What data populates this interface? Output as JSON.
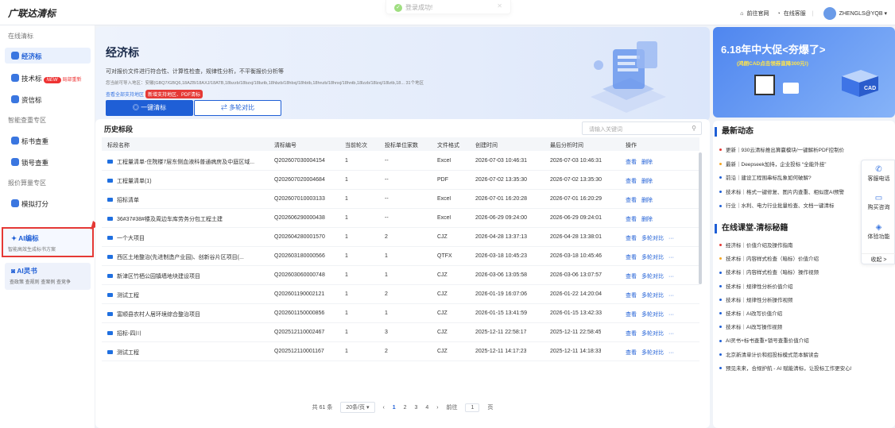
{
  "app": {
    "logo": "广联达清标",
    "toast": "登录成功!",
    "nav_official": "前往官网",
    "nav_service": "在线客服",
    "user": "ZHENGLS@YQB ▾"
  },
  "sidebar": {
    "group1": "在线清标",
    "item_jjb": "经济标",
    "item_jsb": "技术标",
    "new_badge": "NEW",
    "new_text": "局部重新",
    "item_zxb": "资信标",
    "group2": "智能查重专区",
    "item_bscz": "标书查重",
    "item_scz": "锁号查重",
    "group3": "报价算量专区",
    "item_mndf": "模拟打分",
    "ai_title": "AI编标",
    "ai_sub": "智能高效生成标书方案",
    "ling_title": "AI灵书",
    "ling_sub": "查政策 查规则 查案例 查竞争"
  },
  "hero": {
    "title": "经济标",
    "desc": "可对报价文件进行符合性、计算性检查，规律性分析，不平衡报价分析等",
    "formats": "您当前可导入地区：安徽(GBQ7/GBQ6,18AZB/18AXJ/18ATB,18bzzb/18bzxj/18bztb,18hbzb/18hbxj/18hbtb,18hnzb/18hnxj/18hntb,18lzzb/18lzxj/18lztb,18... 31个地区",
    "supported": "查看全部支持地区",
    "badge": "新增支持地区、PDF清标",
    "btn_primary": "一键清标",
    "btn_secondary": "多轮对比"
  },
  "history": {
    "title": "历史标段",
    "search_placeholder": "请输入关键词",
    "columns": [
      "标段名称",
      "清标编号",
      "当前轮次",
      "投标单位家数",
      "文件格式",
      "创建时间",
      "最后分析时间",
      "操作"
    ],
    "rows": [
      {
        "name": "工程量清单-住院楼7层东侧血液科普通病房及中庭区域...",
        "code": "Q202607030004154",
        "round": "1",
        "count": "--",
        "fmt": "Excel",
        "created": "2026-07-03 10:46:31",
        "last": "2026-07-03 10:46:31",
        "a1": "查看",
        "a2": "删除",
        "a3": ""
      },
      {
        "name": "工程量清单(1)",
        "code": "Q202607020004684",
        "round": "1",
        "count": "--",
        "fmt": "PDF",
        "created": "2026-07-02 13:35:30",
        "last": "2026-07-02 13:35:30",
        "a1": "查看",
        "a2": "删除",
        "a3": ""
      },
      {
        "name": "招标清单",
        "code": "Q202607010003133",
        "round": "1",
        "count": "--",
        "fmt": "Excel",
        "created": "2026-07-01 16:20:28",
        "last": "2026-07-01 16:20:29",
        "a1": "查看",
        "a2": "删除",
        "a3": ""
      },
      {
        "name": "36#37#38#楼及周边车库劳务分包工程土建",
        "code": "Q202606290000438",
        "round": "1",
        "count": "--",
        "fmt": "Excel",
        "created": "2026-06-29 09:24:00",
        "last": "2026-06-29 09:24:01",
        "a1": "查看",
        "a2": "删除",
        "a3": ""
      },
      {
        "name": "一个大项目",
        "code": "Q202604280001570",
        "round": "1",
        "count": "2",
        "fmt": "CJZ",
        "created": "2026-04-28 13:37:13",
        "last": "2026-04-28 13:38:01",
        "a1": "查看",
        "a2": "多轮对比",
        "a3": "···"
      },
      {
        "name": "西区土地整治(先进制造产业园)、创新谷片区项目(...",
        "code": "Q202603180000566",
        "round": "1",
        "count": "1",
        "fmt": "QTFX",
        "created": "2026-03-18 10:45:23",
        "last": "2026-03-18 10:45:46",
        "a1": "查看",
        "a2": "多轮对比",
        "a3": "···"
      },
      {
        "name": "新津区竹栖公园镇墙地块建设项目",
        "code": "Q202603060000748",
        "round": "1",
        "count": "1",
        "fmt": "CJZ",
        "created": "2026-03-06 13:05:58",
        "last": "2026-03-06 13:07:57",
        "a1": "查看",
        "a2": "多轮对比",
        "a3": "···"
      },
      {
        "name": "测试工程",
        "code": "Q202601190002121",
        "round": "1",
        "count": "2",
        "fmt": "CJZ",
        "created": "2026-01-19 16:07:06",
        "last": "2026-01-22 14:20:04",
        "a1": "查看",
        "a2": "多轮对比",
        "a3": "···"
      },
      {
        "name": "富顺县农村人居环境综合整治项目",
        "code": "Q202601150000856",
        "round": "1",
        "count": "1",
        "fmt": "CJZ",
        "created": "2026-01-15 13:41:59",
        "last": "2026-01-15 13:42:33",
        "a1": "查看",
        "a2": "多轮对比",
        "a3": "···"
      },
      {
        "name": "招标-四川",
        "code": "Q202512110002467",
        "round": "1",
        "count": "3",
        "fmt": "CJZ",
        "created": "2025-12-11 22:58:17",
        "last": "2025-12-11 22:58:45",
        "a1": "查看",
        "a2": "多轮对比",
        "a3": "···"
      },
      {
        "name": "测试工程",
        "code": "Q202512110001167",
        "round": "1",
        "count": "2",
        "fmt": "CJZ",
        "created": "2025-12-11 14:17:23",
        "last": "2025-12-11 14:18:33",
        "a1": "查看",
        "a2": "多轮对比",
        "a3": "···"
      }
    ],
    "pager": {
      "total": "共 61 条",
      "per_page": "20条/页 ▾",
      "prev": "‹",
      "p1": "1",
      "p2": "2",
      "p3": "3",
      "p4": "4",
      "next": "›",
      "goto": "前往",
      "goto_val": "1",
      "page_unit": "页"
    }
  },
  "promo": {
    "title": "6.18年中大促<夯爆了>",
    "sub": "(鸿朗CAD点击领券直降300元!)"
  },
  "news": {
    "title": "最新动态",
    "items": [
      "更新｜930云清标推出算赢模块/一键解析PDF控制价",
      "最新｜Deepseek加持，企业投标 “全能外挂”",
      "前沿｜建设工程围串标乱象如何破解?",
      "技术标｜格式一键修复、图片内查重、相似度AI预警",
      "行业｜水利、电力行业批量检查、文档一键清标"
    ],
    "dots": [
      "#e53935",
      "#f5a623",
      "#1f5fd6",
      "#1f5fd6",
      "#1f5fd6"
    ],
    "course_title": "在线课堂-清标秘籍",
    "courses": [
      "经济标｜价值介绍及操作指南",
      "技术标｜内容样式检查（暗标）价值介绍",
      "技术标｜内容样式检查（暗标）操作视频",
      "技术标｜规律性分析价值介绍",
      "技术标｜规律性分析操作视频",
      "技术标｜AI改写价值介绍",
      "技术标｜AI改写操作视频",
      "AI灵书+标书查重+锁号查重价值介绍",
      "北京新清单计价和招投标模式范本解读会",
      "预见未来，合规护航 - AI 赋能清标，让投标工作更安心!"
    ],
    "course_dots": [
      "#e53935",
      "#f5a623",
      "#1f5fd6",
      "#1f5fd6",
      "#1f5fd6",
      "#1f5fd6",
      "#1f5fd6",
      "#1f5fd6",
      "#1f5fd6",
      "#1f5fd6"
    ]
  },
  "float": {
    "phone": "客服电话",
    "buy": "购买咨询",
    "features": "体验功能",
    "collapse": "收起 >"
  }
}
